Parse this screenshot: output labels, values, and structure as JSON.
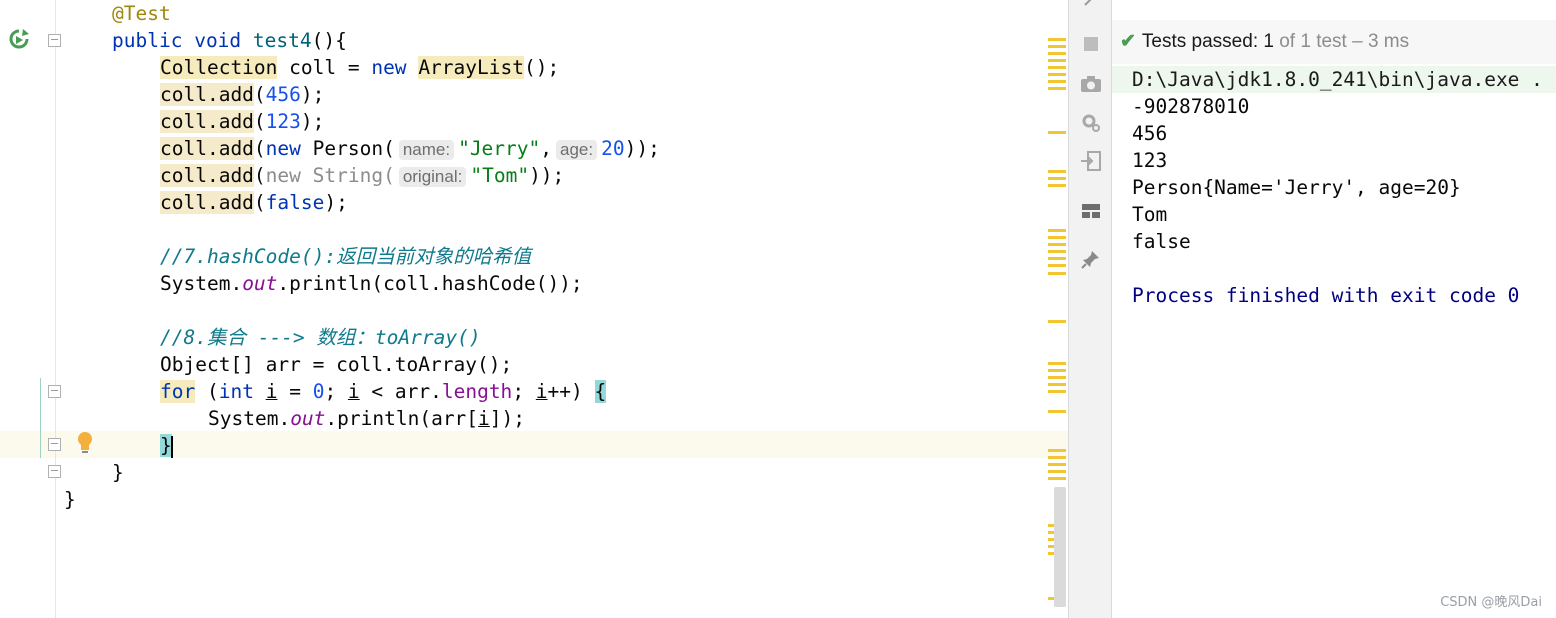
{
  "editor": {
    "annotation": "@Test",
    "method_line": {
      "kw_public": "public",
      "kw_void": "void",
      "name": "test4",
      "tail": "(){"
    },
    "line_collection": {
      "type": "Collection",
      "var": " coll = ",
      "kw_new": "new",
      "space": " ",
      "class": "ArrayList",
      "tail": "();"
    },
    "line_add_456": {
      "call": "coll.add",
      "open": "(",
      "arg": "456",
      "close": ");"
    },
    "line_add_123": {
      "call": "coll.add",
      "open": "(",
      "arg": "123",
      "close": ");"
    },
    "line_add_person": {
      "call": "coll.add",
      "open": "(",
      "kw_new": "new",
      "ctor": " Person(",
      "hint_name": "name:",
      "arg1": "\"Jerry\"",
      "comma": ",",
      "hint_age": "age:",
      "arg2": "20",
      "close": "));"
    },
    "line_add_string": {
      "call": "coll.add",
      "open": "(",
      "ctor": "new String(",
      "hint_original": "original:",
      "arg": "\"Tom\"",
      "close": "));"
    },
    "line_add_false": {
      "call": "coll.add",
      "open": "(",
      "kw_false": "false",
      "close": ");"
    },
    "comment_hashcode": "//7.hashCode():返回当前对象的哈希值",
    "line_println_hash": {
      "a": "System.",
      "out": "out",
      "b": ".println(coll.hashCode());"
    },
    "comment_toarray": "//8.集合 ---> 数组：toArray()",
    "line_toarray": "Object[] arr = coll.toArray();",
    "line_for": {
      "kw_for": "for",
      "p1": " (",
      "kw_int": "int",
      "sp": " ",
      "i1": "i",
      "p2": " = ",
      "zero": "0",
      "p3": "; ",
      "i2": "i",
      "p4": " < arr.",
      "length": "length",
      "p5": "; ",
      "i3": "i",
      "p6": "++) ",
      "brace": "{"
    },
    "line_println_arr": {
      "a": "System.",
      "out": "out",
      "b": ".println(arr[",
      "i": "i",
      "c": "]);"
    },
    "line_close_for": "}",
    "line_close_method": "}",
    "line_close_class": "}"
  },
  "toolbar": {
    "icons": [
      "stop-icon",
      "camera-icon",
      "settings-icon",
      "exit-icon",
      "layout-icon",
      "pin-icon"
    ]
  },
  "console": {
    "status": {
      "passed_label": "Tests passed:",
      "passed_count": "1",
      "of_text": "of 1 test – 3 ms"
    },
    "lines": [
      "D:\\Java\\jdk1.8.0_241\\bin\\java.exe .",
      "-902878010",
      "456",
      "123",
      "Person{Name='Jerry', age=20}",
      "Tom",
      "false",
      "",
      "Process finished with exit code 0"
    ]
  },
  "watermark": "CSDN @晚风Dai",
  "colors": {
    "keyword": "#0033b3",
    "number": "#1750eb",
    "string": "#067d17",
    "comment": "#0f7a8c",
    "success": "#499c54"
  }
}
